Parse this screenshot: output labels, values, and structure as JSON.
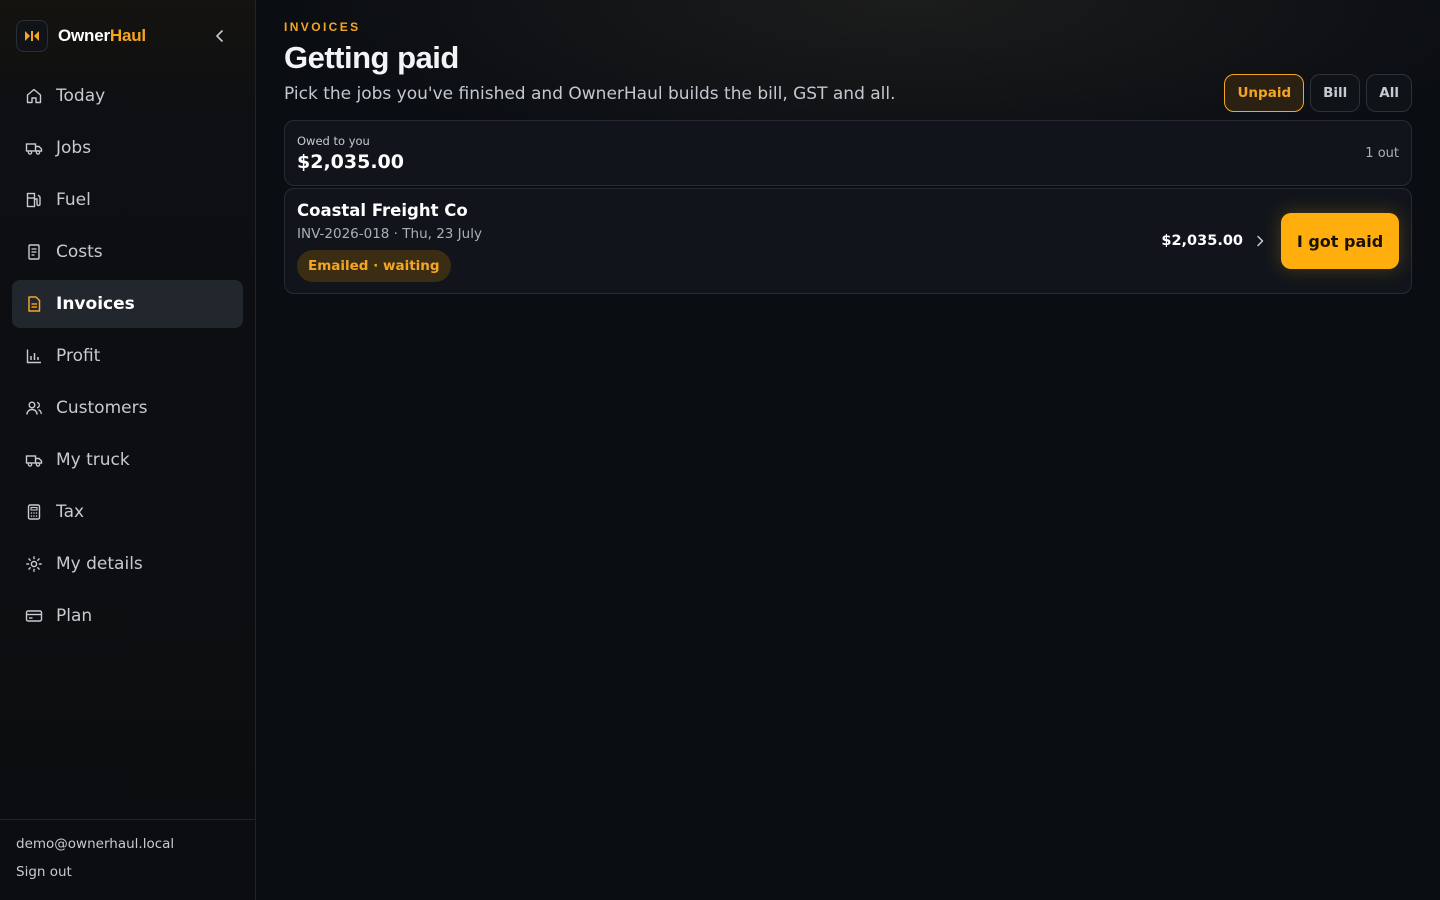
{
  "brand": {
    "name_a": "Owner",
    "name_b": "Haul",
    "logo_icon": "brand-logo-icon"
  },
  "sidebar": {
    "collapse_icon": "chevron-left-icon",
    "items": [
      {
        "label": "Today",
        "icon": "home-icon",
        "active": false
      },
      {
        "label": "Jobs",
        "icon": "truck-icon",
        "active": false
      },
      {
        "label": "Fuel",
        "icon": "fuel-pump-icon",
        "active": false
      },
      {
        "label": "Costs",
        "icon": "receipt-icon",
        "active": false
      },
      {
        "label": "Invoices",
        "icon": "document-icon",
        "active": true
      },
      {
        "label": "Profit",
        "icon": "bar-chart-icon",
        "active": false
      },
      {
        "label": "Customers",
        "icon": "users-icon",
        "active": false
      },
      {
        "label": "My truck",
        "icon": "truck-icon",
        "active": false
      },
      {
        "label": "Tax",
        "icon": "calculator-icon",
        "active": false
      },
      {
        "label": "My details",
        "icon": "gear-icon",
        "active": false
      },
      {
        "label": "Plan",
        "icon": "credit-card-icon",
        "active": false
      }
    ],
    "user_email": "demo@ownerhaul.local",
    "sign_out": "Sign out"
  },
  "header": {
    "eyebrow": "INVOICES",
    "title": "Getting paid",
    "subtitle": "Pick the jobs you've finished and OwnerHaul builds the bill, GST and all."
  },
  "filters": [
    {
      "label": "Unpaid",
      "active": true
    },
    {
      "label": "Bill",
      "active": false
    },
    {
      "label": "All",
      "active": false
    }
  ],
  "summary": {
    "label": "Owed to you",
    "amount": "$2,035.00",
    "count": "1 out"
  },
  "invoices": [
    {
      "customer": "Coastal Freight Co",
      "meta": "INV-2026-018 · Thu, 23 July",
      "status": "Emailed · waiting",
      "amount": "$2,035.00",
      "action": "I got paid"
    }
  ],
  "colors": {
    "accent": "#f5a524",
    "button": "#ffae0d",
    "background": "#0a0d12",
    "card": "#11151b"
  }
}
